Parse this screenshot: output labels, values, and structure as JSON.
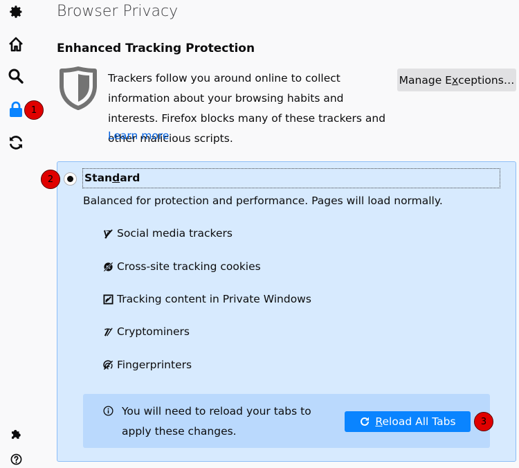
{
  "sidebar": {
    "items": [
      {
        "name": "general",
        "icon": "gear-icon"
      },
      {
        "name": "home",
        "icon": "home-icon"
      },
      {
        "name": "search",
        "icon": "search-icon"
      },
      {
        "name": "privacy",
        "icon": "lock-icon",
        "active": true
      },
      {
        "name": "sync",
        "icon": "sync-icon"
      }
    ],
    "bottom": [
      {
        "name": "extensions",
        "icon": "puzzle-icon"
      },
      {
        "name": "help",
        "icon": "help-icon"
      }
    ]
  },
  "badges": {
    "b1": "1",
    "b2": "2",
    "b3": "3"
  },
  "page": {
    "title": "Browser Privacy"
  },
  "etp": {
    "title": "Enhanced Tracking Protection",
    "description": "Trackers follow you around online to collect information about your browsing habits and interests. Firefox blocks many of these trackers and other malicious scripts.",
    "learn_more": "Learn more",
    "manage_exceptions_pre": "Manage E",
    "manage_exceptions_key": "x",
    "manage_exceptions_post": "ceptions…"
  },
  "standard": {
    "label_pre": "Stan",
    "label_key": "d",
    "label_post": "ard",
    "selected": true,
    "description": "Balanced for protection and performance. Pages will load normally.",
    "categories": [
      {
        "icon": "social-tracker-icon",
        "label": "Social media trackers"
      },
      {
        "icon": "cookie-icon",
        "label": "Cross-site tracking cookies"
      },
      {
        "icon": "tracking-content-icon",
        "label": "Tracking content in Private Windows"
      },
      {
        "icon": "cryptominer-icon",
        "label": "Cryptominers"
      },
      {
        "icon": "fingerprinter-icon",
        "label": "Fingerprinters"
      }
    ]
  },
  "reload": {
    "message": "You will need to reload your tabs to apply these changes.",
    "button_key": "R",
    "button_rest": "eload All Tabs"
  },
  "colors": {
    "accent": "#0a84ff",
    "link": "#0060df",
    "panel_bg": "#d7eafe",
    "badge": "#e00000"
  }
}
